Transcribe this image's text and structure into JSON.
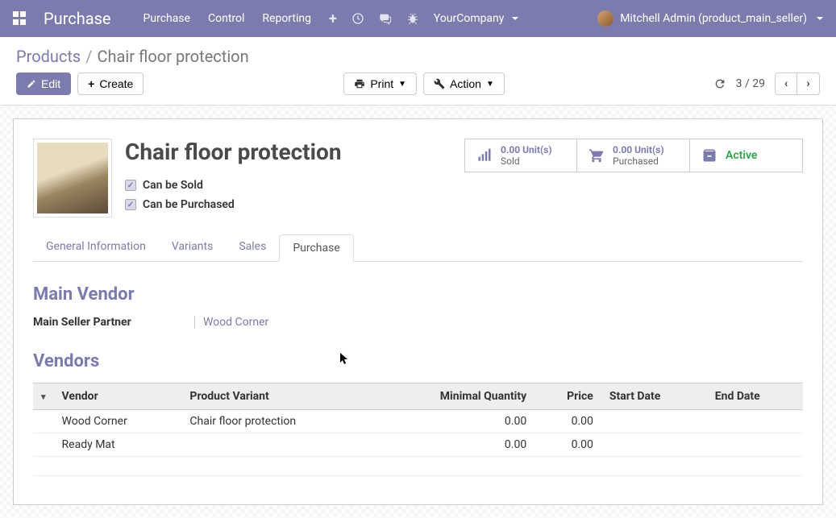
{
  "nav": {
    "brand": "Purchase",
    "items": [
      "Purchase",
      "Control",
      "Reporting"
    ],
    "company": "YourCompany",
    "user": "Mitchell Admin (product_main_seller)"
  },
  "breadcrumb": {
    "parent": "Products",
    "current": "Chair floor protection"
  },
  "toolbar": {
    "edit": "Edit",
    "create": "Create",
    "print": "Print",
    "action": "Action",
    "pager": "3 / 29"
  },
  "product": {
    "name": "Chair floor protection",
    "can_be_sold_label": "Can be Sold",
    "can_be_purchased_label": "Can be Purchased",
    "stats": {
      "sold_value": "0.00 Unit(s)",
      "sold_label": "Sold",
      "purchased_value": "0.00 Unit(s)",
      "purchased_label": "Purchased",
      "active_label": "Active"
    }
  },
  "tabs": {
    "general": "General Information",
    "variants": "Variants",
    "sales": "Sales",
    "purchase": "Purchase"
  },
  "main_vendor": {
    "heading": "Main Vendor",
    "label": "Main Seller Partner",
    "value": "Wood Corner"
  },
  "vendors": {
    "heading": "Vendors",
    "columns": {
      "vendor": "Vendor",
      "variant": "Product Variant",
      "min_qty": "Minimal Quantity",
      "price": "Price",
      "start": "Start Date",
      "end": "End Date"
    },
    "rows": [
      {
        "vendor": "Wood Corner",
        "variant": "Chair floor protection",
        "min_qty": "0.00",
        "price": "0.00",
        "start": "",
        "end": ""
      },
      {
        "vendor": "Ready Mat",
        "variant": "",
        "min_qty": "0.00",
        "price": "0.00",
        "start": "",
        "end": ""
      }
    ]
  }
}
